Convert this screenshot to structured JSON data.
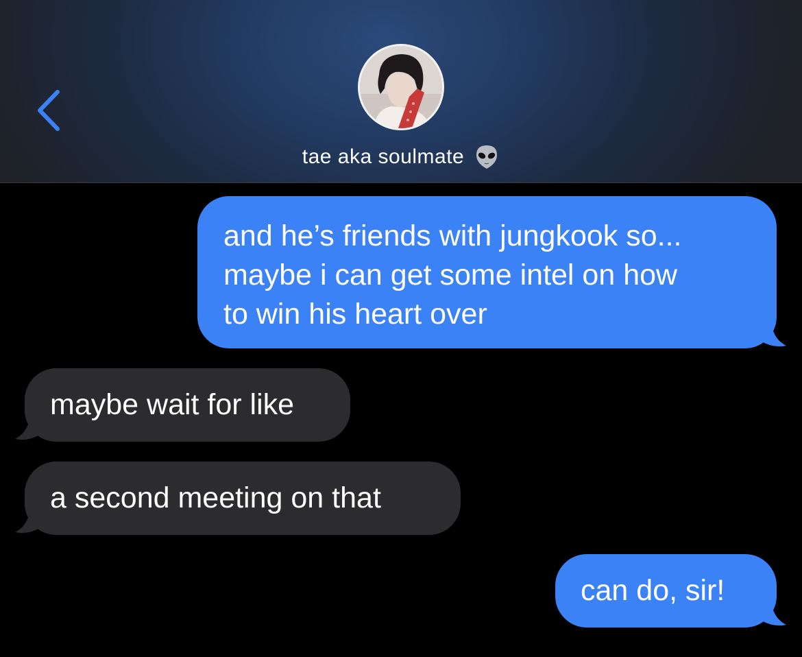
{
  "header": {
    "contact_name": "tae aka soulmate",
    "status_emoji_icon": "alien-icon",
    "back_icon": "chevron-left-icon"
  },
  "colors": {
    "sent_bubble": "#3b82f6",
    "received_bubble": "#2c2c2e",
    "accent": "#3b82f6",
    "background": "#000000"
  },
  "messages": [
    {
      "direction": "sent",
      "text": "and he’s friends with jungkook so...\nmaybe i can get some intel on how\nto win his heart over"
    },
    {
      "direction": "received",
      "text": "maybe wait for like"
    },
    {
      "direction": "received",
      "text": "a second meeting on that"
    },
    {
      "direction": "sent",
      "text": "can do, sir!"
    }
  ]
}
